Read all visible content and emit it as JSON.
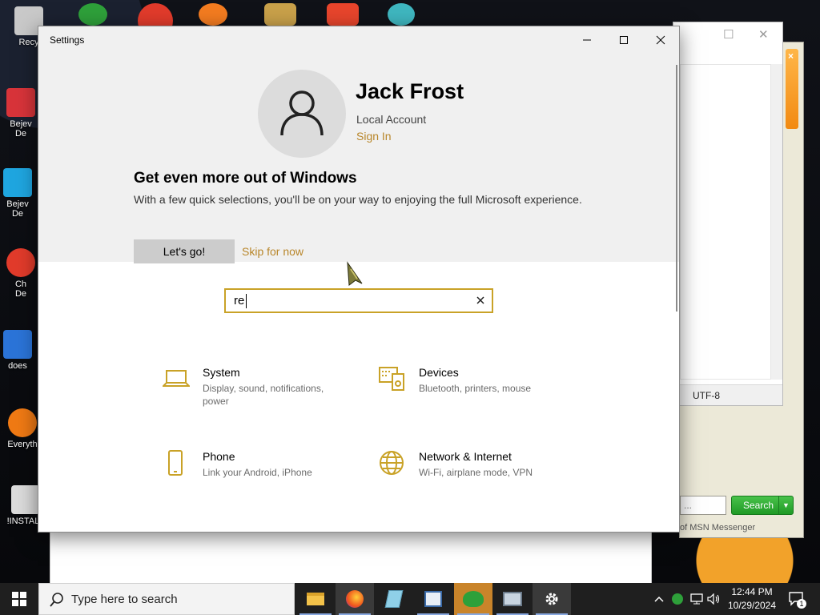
{
  "settings_window": {
    "title": "Settings",
    "profile": {
      "name": "Jack Frost",
      "account_type": "Local Account",
      "sign_in_link": "Sign In"
    },
    "promo": {
      "title": "Get even more out of Windows",
      "text": "With a few quick selections, you'll be on your way to enjoying the full Microsoft experience.",
      "primary_button": "Let's go!",
      "secondary_link": "Skip for now"
    },
    "search": {
      "value": "re"
    },
    "categories": [
      {
        "title": "System",
        "description": "Display, sound, notifications, power",
        "icon": "laptop-icon"
      },
      {
        "title": "Devices",
        "description": "Bluetooth, printers, mouse",
        "icon": "devices-icon"
      },
      {
        "title": "Phone",
        "description": "Link your Android, iPhone",
        "icon": "phone-icon"
      },
      {
        "title": "Network & Internet",
        "description": "Wi-Fi, airplane mode, VPN",
        "icon": "globe-icon"
      }
    ]
  },
  "desktop": {
    "icons": [
      {
        "label": "Recy",
        "icon": "recycle-bin-icon",
        "color": "#c9c9c9"
      },
      {
        "label": "Bejev",
        "icon": "bejeweled-icon",
        "color": "#d8343a"
      },
      {
        "label": "Bejev",
        "icon": "bejeweled-icon",
        "color": "#1fa6e0"
      },
      {
        "label": "Ch",
        "icon": "chrome-shortcut-icon",
        "color": "#e23b2b"
      },
      {
        "label": "does",
        "icon": "shortcut-icon",
        "color": "#2b74d8"
      },
      {
        "label": "Everyth",
        "icon": "everything-icon",
        "color": "#f07a14"
      },
      {
        "label": "!INSTALL",
        "icon": "installer-icon",
        "color": "#dcdcdc"
      }
    ],
    "icon_second_lines": [
      "De",
      "De",
      "De"
    ]
  },
  "background_windows": {
    "encoding_status": "UTF-8",
    "messenger": {
      "search_button": "Search",
      "footer": "of MSN Messenger"
    }
  },
  "taskbar": {
    "search_placeholder": "Type here to search",
    "time": "12:44 PM",
    "date": "10/29/2024",
    "notification_count": "1",
    "apps": [
      "file-explorer-icon",
      "firefox-icon",
      "notepad-icon",
      "wordpad-icon",
      "msn-messenger-icon",
      "network-icon",
      "settings-gear-icon"
    ]
  },
  "colors": {
    "accent": "#c9a227",
    "link": "#b8862a",
    "hero_bg": "#f0f0f0",
    "taskbar_bg": "#1f1f1f"
  }
}
